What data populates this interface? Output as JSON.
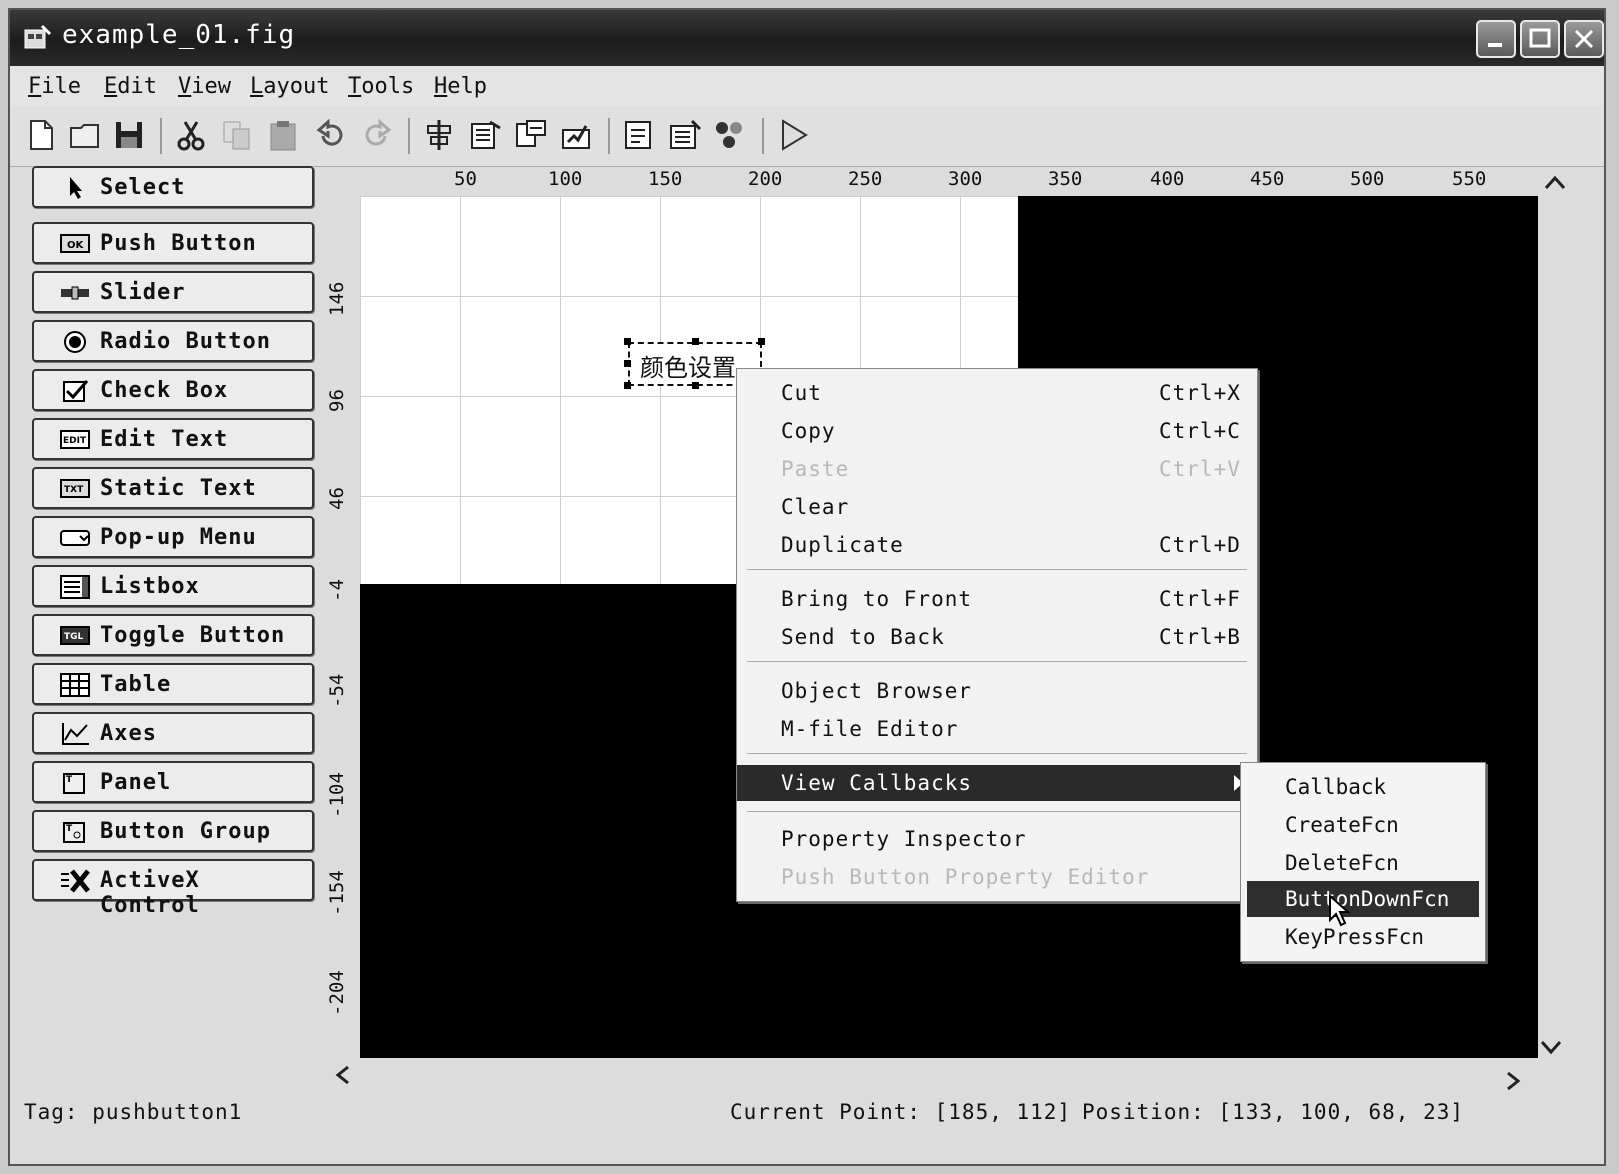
{
  "window": {
    "title": "example_01.fig"
  },
  "menubar": [
    {
      "u": "F",
      "rest": "ile"
    },
    {
      "u": "E",
      "rest": "dit"
    },
    {
      "u": "V",
      "rest": "iew"
    },
    {
      "u": "L",
      "rest": "ayout"
    },
    {
      "u": "T",
      "rest": "ools"
    },
    {
      "u": "H",
      "rest": "elp"
    }
  ],
  "toolbar": {
    "icons": [
      "new-icon",
      "open-icon",
      "save-icon",
      "cut-icon",
      "copy-icon",
      "paste-icon",
      "undo-icon",
      "redo-icon",
      "align-icon",
      "menu-editor-icon",
      "tab-order-icon",
      "toolbar-editor-icon",
      "mfile-editor-icon",
      "property-inspector-icon",
      "object-browser-icon",
      "run-icon"
    ]
  },
  "palette": [
    {
      "label": "Select",
      "icon": "arrow-icon"
    },
    {
      "label": "Push Button",
      "icon": "ok-icon"
    },
    {
      "label": "Slider",
      "icon": "slider-icon"
    },
    {
      "label": "Radio Button",
      "icon": "radio-icon"
    },
    {
      "label": "Check Box",
      "icon": "checkbox-icon"
    },
    {
      "label": "Edit Text",
      "icon": "edit-text-icon"
    },
    {
      "label": "Static Text",
      "icon": "static-text-icon"
    },
    {
      "label": "Pop-up Menu",
      "icon": "popup-icon"
    },
    {
      "label": "Listbox",
      "icon": "listbox-icon"
    },
    {
      "label": "Toggle Button",
      "icon": "toggle-icon"
    },
    {
      "label": "Table",
      "icon": "table-icon"
    },
    {
      "label": "Axes",
      "icon": "axes-icon"
    },
    {
      "label": "Panel",
      "icon": "panel-icon"
    },
    {
      "label": "Button Group",
      "icon": "button-group-icon"
    },
    {
      "label": "ActiveX Control",
      "icon": "activex-icon"
    }
  ],
  "ruler": {
    "h": [
      "50",
      "100",
      "150",
      "200",
      "250",
      "300",
      "350",
      "400",
      "450",
      "500",
      "550"
    ],
    "v": [
      "146",
      "96",
      "46",
      "-4",
      "-54",
      "-104",
      "-154",
      "-204"
    ]
  },
  "canvas": {
    "button_text": "颜色设置"
  },
  "context_menu": {
    "items": [
      {
        "label": "Cut",
        "shortcut": "Ctrl+X"
      },
      {
        "label": "Copy",
        "shortcut": "Ctrl+C"
      },
      {
        "label": "Paste",
        "shortcut": "Ctrl+V",
        "disabled": true
      },
      {
        "label": "Clear",
        "shortcut": ""
      },
      {
        "label": "Duplicate",
        "shortcut": "Ctrl+D"
      },
      {
        "label": "Bring to Front",
        "shortcut": "Ctrl+F"
      },
      {
        "label": "Send to Back",
        "shortcut": "Ctrl+B"
      },
      {
        "label": "Object Browser",
        "shortcut": ""
      },
      {
        "label": "M-file Editor",
        "shortcut": ""
      },
      {
        "label": "View Callbacks",
        "shortcut": "",
        "highlight": true,
        "submenu": true
      },
      {
        "label": "Property Inspector",
        "shortcut": ""
      },
      {
        "label": "Push Button Property Editor",
        "shortcut": "",
        "disabled": true
      }
    ]
  },
  "submenu": {
    "items": [
      {
        "label": "Callback"
      },
      {
        "label": "CreateFcn"
      },
      {
        "label": "DeleteFcn"
      },
      {
        "label": "ButtonDownFcn",
        "highlight": true
      },
      {
        "label": "KeyPressFcn"
      }
    ]
  },
  "status": {
    "tag": "Tag: pushbutton1",
    "current_point": "Current Point: [185, 112]",
    "position": "Position: [133, 100, 68, 23]"
  }
}
